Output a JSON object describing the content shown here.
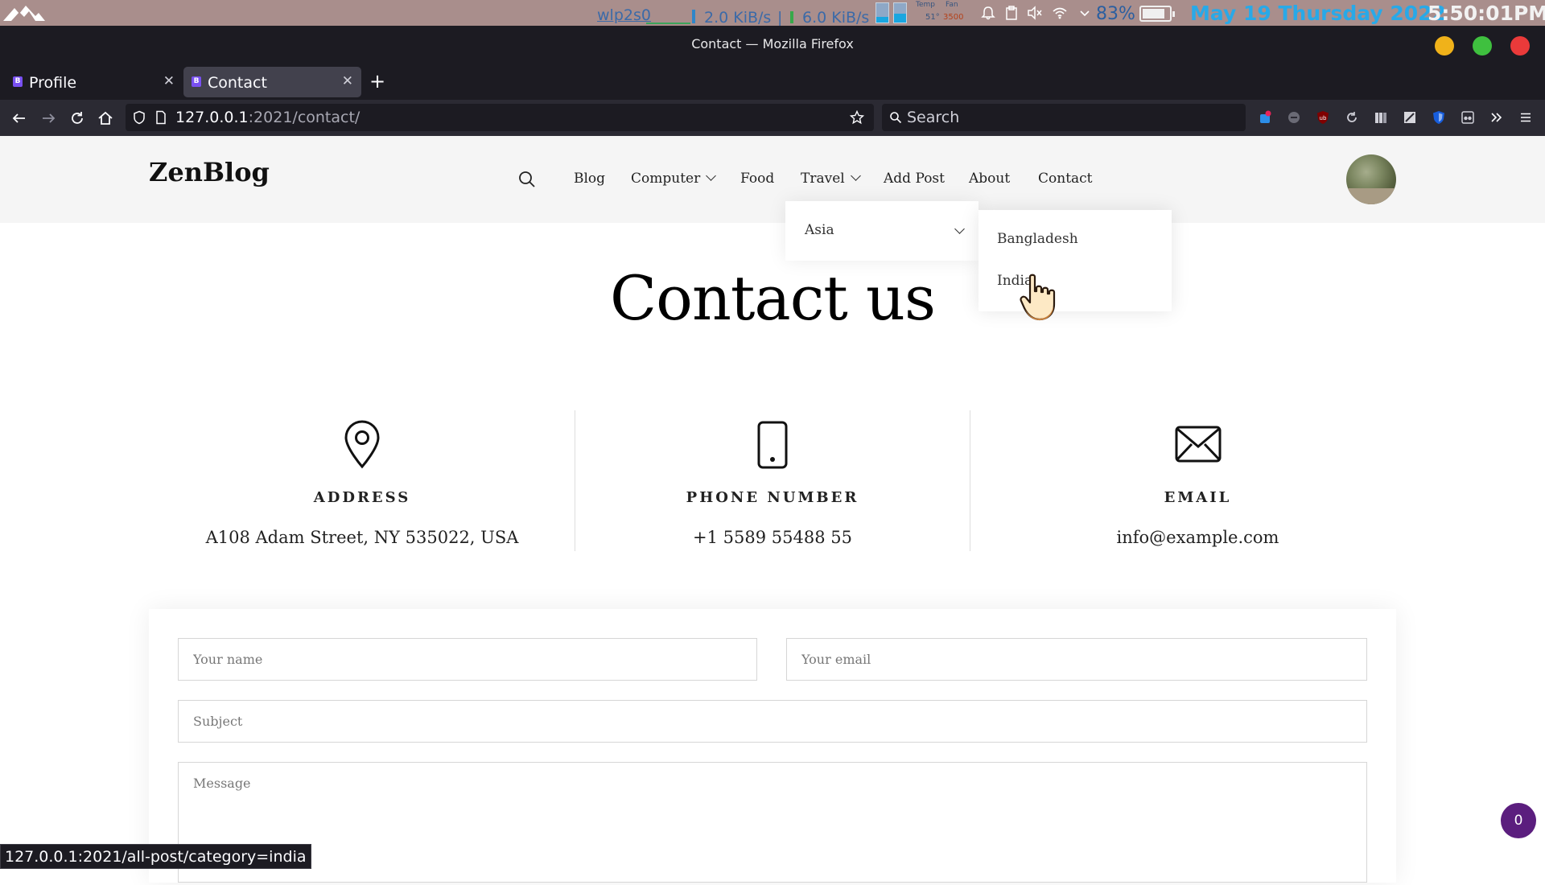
{
  "system_bar": {
    "net_interface": "wlp2s0",
    "download": "2.0 KiB/s",
    "separator": "|",
    "upload": "6.0 KiB/s",
    "temp_label": "Temp",
    "fan_label": "Fan",
    "temp_value": "51°",
    "fan_value": "3500",
    "battery_percent": "83%",
    "battery_level": 0.83,
    "date": "May 19 Thursday 2022",
    "time": "5:50:01PM"
  },
  "window": {
    "title": "Contact — Mozilla Firefox"
  },
  "tabs": [
    {
      "label": "Profile",
      "favicon": "B",
      "active": false
    },
    {
      "label": "Contact",
      "favicon": "B",
      "active": true
    }
  ],
  "toolbar": {
    "url_host": "127.0.0.1",
    "url_rest": ":2021/contact/",
    "search_placeholder": "Search"
  },
  "site": {
    "brand": "ZenBlog",
    "nav": [
      {
        "label": "Blog"
      },
      {
        "label": "Computer"
      },
      {
        "label": "Food"
      },
      {
        "label": "Travel"
      },
      {
        "label": "Add Post"
      },
      {
        "label": "About"
      },
      {
        "label": "Contact"
      }
    ],
    "travel_menu": {
      "item": "Asia"
    },
    "asia_submenu": [
      "Bangladesh",
      "India"
    ]
  },
  "page": {
    "heading": "Contact us",
    "info": [
      {
        "label": "ADDRESS",
        "value": "A108 Adam Street, NY 535022, USA",
        "icon": "map-pin-icon"
      },
      {
        "label": "PHONE NUMBER",
        "value": "+1 5589 55488 55",
        "icon": "phone-icon"
      },
      {
        "label": "EMAIL",
        "value": "info@example.com",
        "icon": "envelope-icon"
      }
    ],
    "form": {
      "name_placeholder": "Your name",
      "email_placeholder": "Your email",
      "subject_placeholder": "Subject",
      "message_placeholder": "Message"
    }
  },
  "status_url": "127.0.0.1:2021/all-post/category=india",
  "badge_count": "0"
}
